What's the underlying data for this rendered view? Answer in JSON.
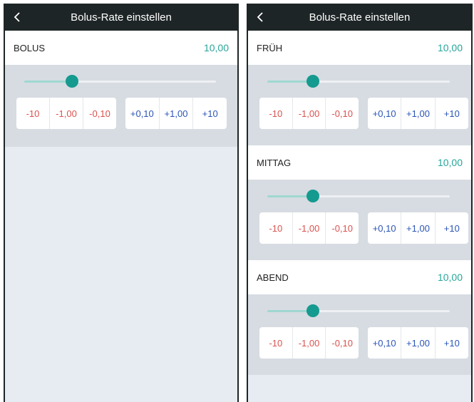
{
  "left_screen": {
    "title": "Bolus-Rate einstellen",
    "rows": [
      {
        "label": "BOLUS",
        "value": "10,00",
        "slider_level": 0.25,
        "minus_buttons": [
          "-10",
          "-1,00",
          "-0,10"
        ],
        "plus_buttons": [
          "+0,10",
          "+1,00",
          "+10"
        ]
      }
    ]
  },
  "right_screen": {
    "title": "Bolus-Rate einstellen",
    "rows": [
      {
        "label": "FRÜH",
        "value": "10,00",
        "slider_level": 0.25,
        "minus_buttons": [
          "-10",
          "-1,00",
          "-0,10"
        ],
        "plus_buttons": [
          "+0,10",
          "+1,00",
          "+10"
        ]
      },
      {
        "label": "MITTAG",
        "value": "10,00",
        "slider_level": 0.25,
        "minus_buttons": [
          "-10",
          "-1,00",
          "-0,10"
        ],
        "plus_buttons": [
          "+0,10",
          "+1,00",
          "+10"
        ]
      },
      {
        "label": "ABEND",
        "value": "10,00",
        "slider_level": 0.25,
        "minus_buttons": [
          "-10",
          "-1,00",
          "-0,10"
        ],
        "plus_buttons": [
          "+0,10",
          "+1,00",
          "+10"
        ]
      }
    ]
  },
  "colors": {
    "title_bar": "#1e2526",
    "accent_teal": "#159a8f",
    "value_text": "#26a69a",
    "minus_text": "#d9534f",
    "plus_text": "#2b55b6",
    "panel_bg": "#d7dce2",
    "screen_bg": "#e7ebf2"
  },
  "icons": {
    "back": "chevron-left-icon"
  }
}
